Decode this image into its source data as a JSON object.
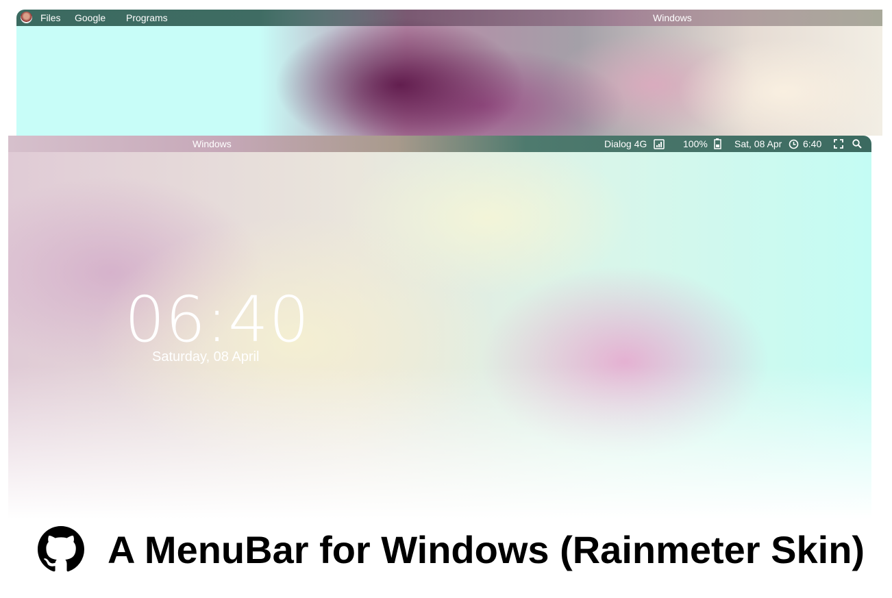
{
  "top_menubar": {
    "items": [
      "Files",
      "Google",
      "Programs"
    ],
    "window_title": "Windows"
  },
  "bottom_menubar": {
    "window_title": "Windows",
    "network": "Dialog 4G",
    "battery": "100%",
    "date": "Sat, 08 Apr",
    "time": "6:40"
  },
  "lockscreen": {
    "clock": "06:40",
    "date": "Saturday, 08 April"
  },
  "banner": {
    "title": "A MenuBar for Windows (Rainmeter Skin)"
  },
  "colors": {
    "bar_teal": "#3b6a60"
  }
}
